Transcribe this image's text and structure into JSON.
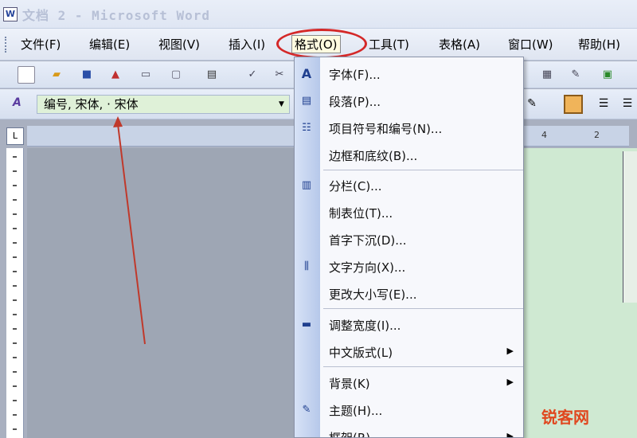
{
  "window": {
    "title": "文档 2 - Microsoft Word",
    "app_icon": "word-document-icon"
  },
  "menubar": {
    "items": [
      {
        "label": "文件(F)",
        "name": "file"
      },
      {
        "label": "编辑(E)",
        "name": "edit"
      },
      {
        "label": "视图(V)",
        "name": "view"
      },
      {
        "label": "插入(I)",
        "name": "insert"
      },
      {
        "label": "格式(O)",
        "name": "format",
        "active": true
      },
      {
        "label": "工具(T)",
        "name": "tools"
      },
      {
        "label": "表格(A)",
        "name": "table"
      },
      {
        "label": "窗口(W)",
        "name": "window"
      },
      {
        "label": "帮助(H)",
        "name": "help"
      }
    ]
  },
  "formatting_toolbar": {
    "style_value": "编号, 宋体, · 宋体"
  },
  "format_menu": {
    "items": [
      {
        "label": "字体(F)...",
        "icon": "font-A-icon"
      },
      {
        "label": "段落(P)...",
        "icon": "paragraph-icon"
      },
      {
        "label": "项目符号和编号(N)...",
        "icon": "bullets-icon"
      },
      {
        "label": "边框和底纹(B)...",
        "icon": ""
      },
      {
        "label": "分栏(C)...",
        "icon": "columns-icon"
      },
      {
        "label": "制表位(T)...",
        "icon": ""
      },
      {
        "label": "首字下沉(D)...",
        "icon": ""
      },
      {
        "label": "文字方向(X)...",
        "icon": "text-direction-icon"
      },
      {
        "label": "更改大小写(E)...",
        "icon": ""
      },
      {
        "label": "调整宽度(I)...",
        "icon": "adjust-width-icon"
      },
      {
        "label": "中文版式(L)",
        "icon": "",
        "submenu": true
      },
      {
        "label": "背景(K)",
        "icon": "",
        "submenu": true
      },
      {
        "label": "主题(H)...",
        "icon": "theme-icon"
      },
      {
        "label": "框架(R)",
        "icon": "",
        "submenu": true
      }
    ]
  },
  "ruler": {
    "numbers": [
      "4",
      "2"
    ]
  },
  "watermark": "锐客网",
  "colors": {
    "highlight_ring": "#d42828",
    "annotation_arrow": "#c0392b",
    "style_box_bg": "#dff1d8"
  }
}
